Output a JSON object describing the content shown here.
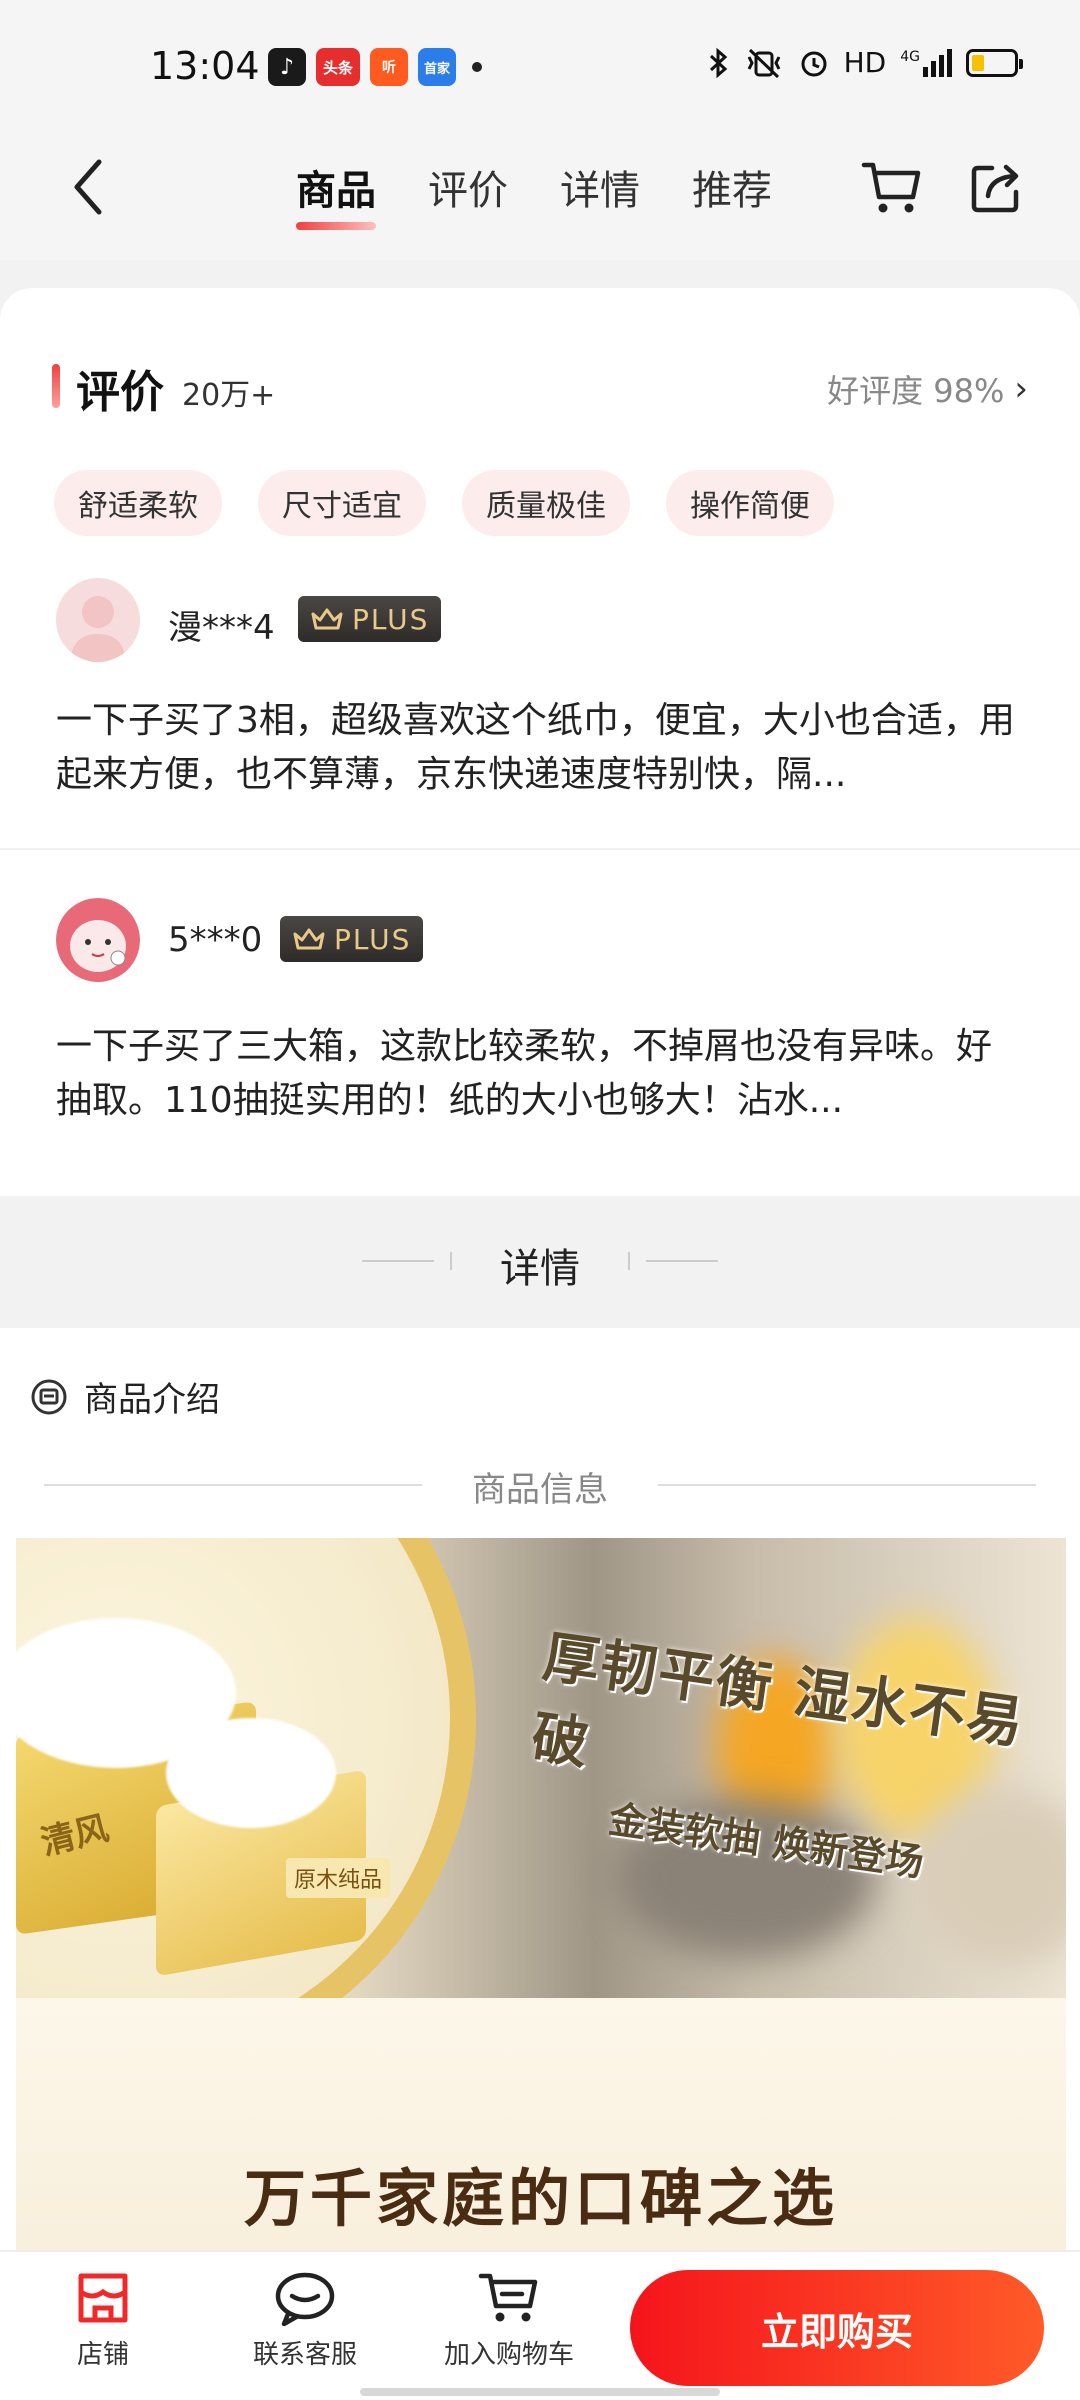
{
  "status_bar": {
    "time": "13:04",
    "notif_apps": [
      "tiktok",
      "头条",
      "听",
      "首家"
    ],
    "indicators": "HD",
    "network": "4G"
  },
  "nav": {
    "tabs": [
      {
        "label": "商品",
        "active": true
      },
      {
        "label": "评价",
        "active": false
      },
      {
        "label": "详情",
        "active": false
      },
      {
        "label": "推荐",
        "active": false
      }
    ]
  },
  "reviews": {
    "title": "评价",
    "count": "20万+",
    "rating": "好评度 98%",
    "tags": [
      "舒适柔软",
      "尺寸适宜",
      "质量极佳",
      "操作简便"
    ],
    "items": [
      {
        "user": "漫***4",
        "badge": "PLUS",
        "text": "一下子买了3相，超级喜欢这个纸巾，便宜，大小也合适，用起来方便，也不算薄，京东快递速度特别快，隔..."
      },
      {
        "user": "5***0",
        "badge": "PLUS",
        "text": "一下子买了三大箱，这款比较柔软，不掉屑也没有异味。好抽取。110抽挺实用的！纸的大小也够大！沾水..."
      }
    ]
  },
  "details_divider": "详情",
  "intro": {
    "title": "商品介绍",
    "section_label": "商品信息",
    "banner_slogan_1": "厚韧平衡 湿水不易破",
    "banner_slogan_2": "金装软抽 焕新登场",
    "brand": "清风",
    "box_label": "原木纯品",
    "slogan": "万千家庭的口碑之选"
  },
  "bottom_bar": {
    "store": "店铺",
    "service": "联系客服",
    "add_cart": "加入购物车",
    "buy_now": "立即购买"
  },
  "colors": {
    "accent": "#f5141c",
    "tag_bg": "#fcecec",
    "plus_gold": "#e8c98a"
  }
}
